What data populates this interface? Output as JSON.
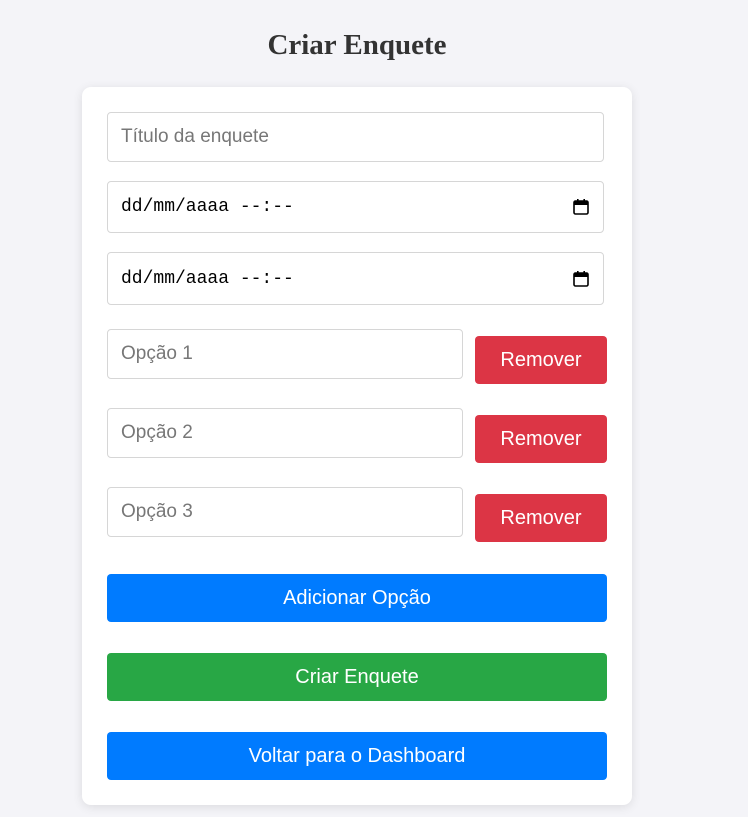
{
  "page": {
    "title": "Criar Enquete"
  },
  "form": {
    "title_placeholder": "Título da enquete",
    "start_datetime_display": "dd/mm/aaaa --:--",
    "end_datetime_display": "dd/mm/aaaa --:--",
    "options": [
      {
        "placeholder": "Opção 1",
        "remove_label": "Remover"
      },
      {
        "placeholder": "Opção 2",
        "remove_label": "Remover"
      },
      {
        "placeholder": "Opção 3",
        "remove_label": "Remover"
      }
    ],
    "add_option_label": "Adicionar Opção",
    "create_label": "Criar Enquete",
    "back_label": "Voltar para o Dashboard"
  },
  "icons": {
    "datetime_picker": "calendar-icon"
  },
  "colors": {
    "remove": "#dc3545",
    "primary": "#007bff",
    "success": "#28a745"
  }
}
